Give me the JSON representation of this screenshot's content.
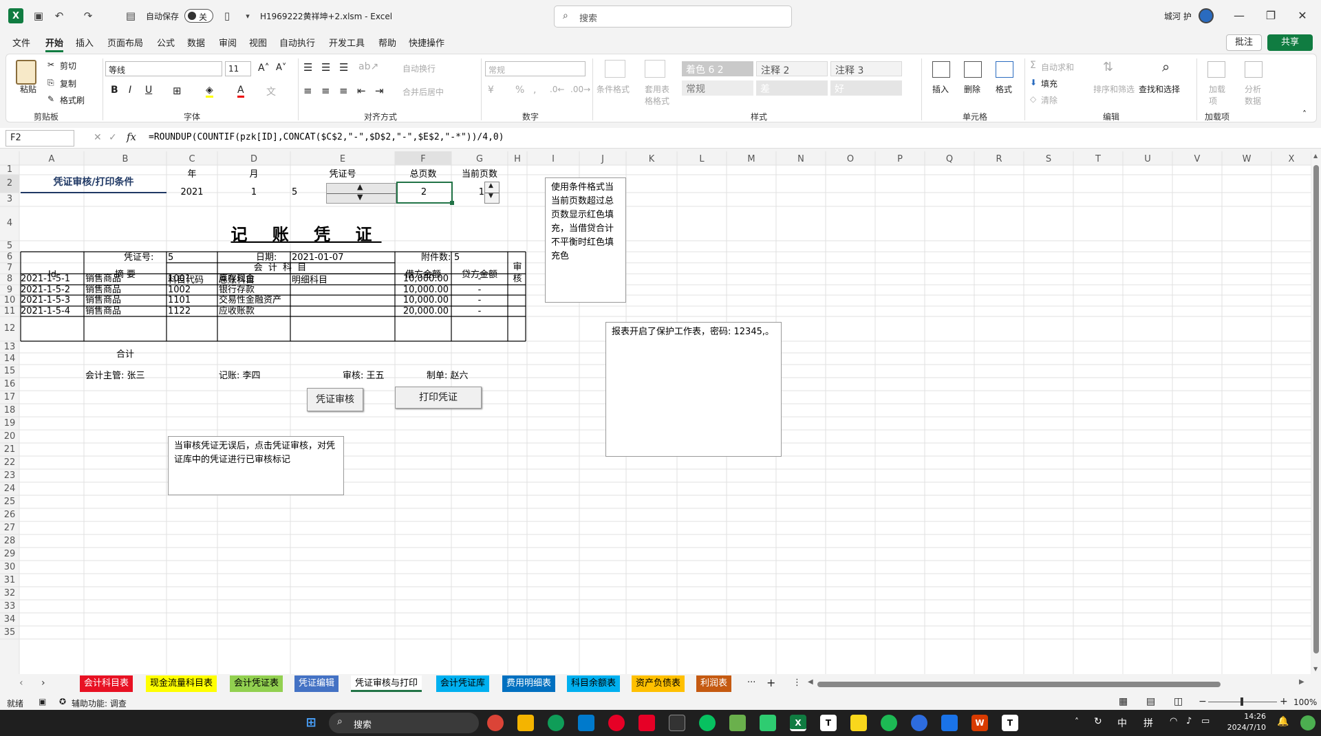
{
  "titlebar": {
    "autosave_label": "自动保存",
    "autosave_state": "关",
    "filename": "H1969222黄祥坤+2.xlsm  -  Excel",
    "search_placeholder": "搜索",
    "user_name": "城河 护"
  },
  "menu": {
    "items": [
      "文件",
      "开始",
      "插入",
      "页面布局",
      "公式",
      "数据",
      "审阅",
      "视图",
      "自动执行",
      "开发工具",
      "帮助",
      "快捷操作"
    ],
    "active": "开始",
    "comment_label": "批注",
    "share_label": "共享"
  },
  "ribbon": {
    "clipboard": {
      "paste": "粘贴",
      "cut": "剪切",
      "copy": "复制",
      "format_painter": "格式刷",
      "group": "剪贴板"
    },
    "font": {
      "name": "等线",
      "size": "11",
      "group": "字体",
      "bold": "B",
      "italic": "I",
      "underline": "U"
    },
    "alignment": {
      "wrap": "自动换行",
      "merge": "合并后居中",
      "group": "对齐方式"
    },
    "number": {
      "format": "常规",
      "group": "数字"
    },
    "styles": {
      "conditional": "条件格式",
      "table": "套用表格格式",
      "cells": [
        "着色 6 2",
        "注释 2",
        "注释 3",
        "常规",
        "差",
        "好"
      ],
      "group": "样式"
    },
    "cells_group": {
      "insert": "插入",
      "delete": "删除",
      "format": "格式",
      "group": "单元格"
    },
    "editing": {
      "autosum": "自动求和",
      "fill": "填充",
      "clear": "清除",
      "sort": "排序和筛选",
      "find": "查找和选择",
      "group": "编辑"
    },
    "addins": {
      "addin": "加载项",
      "analyze": "分析数据",
      "group": "加载项"
    }
  },
  "formula_bar": {
    "name_box": "F2",
    "formula": "=ROUNDUP(COUNTIF(pzk[ID],CONCAT($C$2,\"-\",$D$2,\"-\",$E$2,\"-*\"))/4,0)"
  },
  "columns": [
    "A",
    "B",
    "C",
    "D",
    "E",
    "F",
    "G",
    "H",
    "I",
    "J",
    "K",
    "L",
    "M",
    "N",
    "O",
    "P",
    "Q",
    "R",
    "S",
    "T",
    "U",
    "V",
    "W",
    "X"
  ],
  "rows": [
    "1",
    "2",
    "3",
    "4",
    "5",
    "6",
    "7",
    "8",
    "9",
    "10",
    "11",
    "12",
    "13",
    "14",
    "15",
    "16",
    "17",
    "18",
    "19",
    "20",
    "21",
    "22",
    "23",
    "24",
    "25",
    "26",
    "27",
    "28",
    "29",
    "30",
    "31",
    "32",
    "33",
    "34",
    "35"
  ],
  "sheet": {
    "header_title": "凭证审核/打印条件",
    "h_year": "年",
    "h_month": "月",
    "h_voucher": "凭证号",
    "h_total_pages": "总页数",
    "h_current_page": "当前页数",
    "year": "2021",
    "month": "1",
    "voucher_no": "5",
    "total_pages": "2",
    "current_page": "1",
    "doc_title": "记  账  凭  证",
    "voucher_label": "凭证号:",
    "voucher_value": "5",
    "date_label": "日期:",
    "date_value": "2021-01-07",
    "attach_label": "附件数:",
    "attach_value": "5",
    "th_id": "Id",
    "th_summary": "摘    要",
    "th_account": "会    计    科    目",
    "th_code": "科目代码",
    "th_general": "总账科目",
    "th_detail": "明细科目",
    "th_debit": "借方金额",
    "th_credit": "贷方金额",
    "th_audit": "审核",
    "entries": [
      {
        "id": "2021-1-5-1",
        "summary": "销售商品",
        "code": "1001",
        "account": "库存现金",
        "debit": "10,000.00",
        "credit": "-"
      },
      {
        "id": "2021-1-5-2",
        "summary": "销售商品",
        "code": "1002",
        "account": "银行存款",
        "debit": "10,000.00",
        "credit": "-"
      },
      {
        "id": "2021-1-5-3",
        "summary": "销售商品",
        "code": "1101",
        "account": "交易性金融资产",
        "debit": "10,000.00",
        "credit": "-"
      },
      {
        "id": "2021-1-5-4",
        "summary": "销售商品",
        "code": "1122",
        "account": "应收账款",
        "debit": "20,000.00",
        "credit": "-"
      }
    ],
    "total_label": "合计",
    "sig_supervisor": "会计主管:  张三",
    "sig_bookkeeper": "记账:  李四",
    "sig_auditor": "审核:  王五",
    "sig_preparer": "制单:  赵六",
    "btn_audit": "凭证审核",
    "btn_print": "打印凭证",
    "note_format": "使用条件格式当当前页数超过总页数显示红色填充，当借贷合计不平衡时红色填充色",
    "note_protect": "报表开启了保护工作表，密码: 12345,。",
    "note_audit": "当审核凭证无误后，点击凭证审核，对凭证库中的凭证进行已审核标记"
  },
  "tabs": [
    {
      "label": "会计科目表",
      "bg": "#e81123",
      "fg": "#ffffff"
    },
    {
      "label": "现金流量科目表",
      "bg": "#ffff00",
      "fg": "#000000"
    },
    {
      "label": "会计凭证表",
      "bg": "#92d050",
      "fg": "#000000"
    },
    {
      "label": "凭证编辑",
      "bg": "#4472c4",
      "fg": "#ffffff"
    },
    {
      "label": "凭证审核与打印",
      "bg": "#ffffff",
      "fg": "#000000"
    },
    {
      "label": "会计凭证库",
      "bg": "#00b0f0",
      "fg": "#000000"
    },
    {
      "label": "费用明细表",
      "bg": "#0070c0",
      "fg": "#ffffff"
    },
    {
      "label": "科目余额表",
      "bg": "#00b0f0",
      "fg": "#000000"
    },
    {
      "label": "资产负债表",
      "bg": "#ffc000",
      "fg": "#000000"
    },
    {
      "label": "利润表",
      "bg": "#c55a11",
      "fg": "#ffffff"
    }
  ],
  "status": {
    "ready": "就绪",
    "accessibility": "辅助功能: 调查",
    "zoom": "100%"
  },
  "taskbar": {
    "search": "搜索",
    "ime1": "中",
    "ime2": "拼",
    "time": "14:26",
    "date": "2024/7/10"
  },
  "colors": {
    "excel_green": "#107c41",
    "selection": "#217346"
  }
}
